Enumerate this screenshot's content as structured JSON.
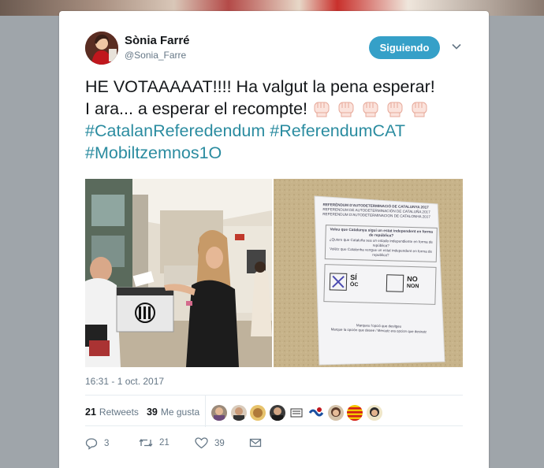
{
  "tweet": {
    "author_name": "Sònia Farré",
    "author_handle": "@Sonia_Farre",
    "follow_label": "Siguiendo",
    "text_line1": "HE VOTAAAAAT!!!! Ha valgut la pena esperar!",
    "text_line2": "I ara... a esperar el recompte!",
    "hashtags": [
      "#CatalanReferedendum",
      "#ReferendumCAT",
      "#Mobiltzemnos1O"
    ],
    "timestamp": "16:31 - 1 oct. 2017",
    "retweets_count": "21",
    "retweets_label": "Retweets",
    "likes_count": "39",
    "likes_label": "Me gusta",
    "actions": {
      "replies": "3",
      "retweets": "21",
      "likes": "39"
    }
  },
  "ballot": {
    "header1": "REFERÈNDUM D'AUTODETERMINACIÓ DE CATALUNYA 2017",
    "header2": "REFERENDUM DE AUTODETERMINACIÓN DE CATALUÑA 2017",
    "header3": "REFERENDUM D'AUTODETERMINACION DE CATALONHA 2017",
    "question1": "Voleu que Catalunya sigui un estat independent en forma de república?",
    "question2": "¿Quiere que Cataluña sea un estado independiente en forma de república?",
    "question3": "Volètz que Catalonha vengue un estat independent en forma de republica?",
    "yes1": "SÍ",
    "yes2": "ÒC",
    "no1": "NO",
    "no2": "NON",
    "footer1": "Marqueu l'opció que desitgeu",
    "footer2": "Marque la opción que desee / Mercatz era opcion que desiratz"
  },
  "colors": {
    "follow_button": "#35a0c8",
    "hashtag": "#2b8ca0"
  },
  "icons": [
    "caret-down-icon",
    "reply-icon",
    "retweet-icon",
    "heart-icon",
    "message-icon",
    "raised-fist-icon"
  ]
}
